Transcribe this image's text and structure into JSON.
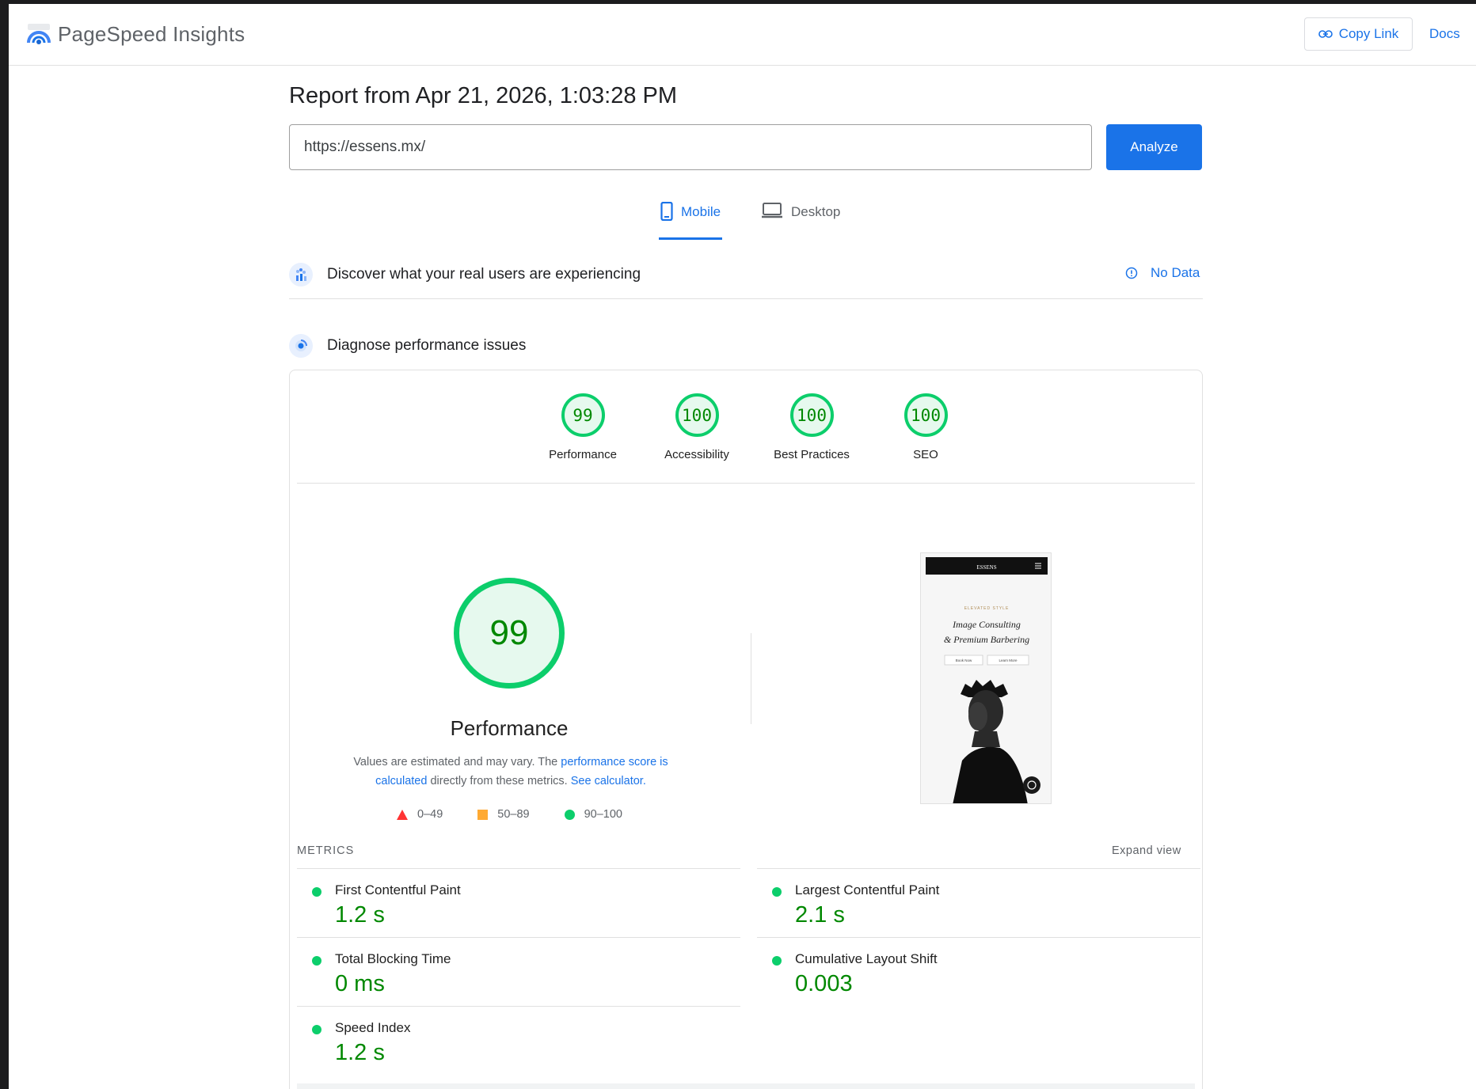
{
  "app": {
    "title": "PageSpeed Insights"
  },
  "topbar": {
    "copy_link": "Copy Link",
    "docs": "Docs"
  },
  "report": {
    "title": "Report from Apr 21, 2026, 1:03:28 PM"
  },
  "search": {
    "url": "https://essens.mx/",
    "analyze": "Analyze"
  },
  "tabs": [
    {
      "label": "Mobile",
      "active": true
    },
    {
      "label": "Desktop",
      "active": false
    }
  ],
  "crux": {
    "title": "Discover what your real users are experiencing",
    "status": "No Data"
  },
  "diagnose": {
    "title": "Diagnose performance issues"
  },
  "categories": [
    {
      "score": "99",
      "label": "Performance"
    },
    {
      "score": "100",
      "label": "Accessibility"
    },
    {
      "score": "100",
      "label": "Best Practices"
    },
    {
      "score": "100",
      "label": "SEO"
    }
  ],
  "performance": {
    "score": "99",
    "label": "Performance",
    "desc_before": "Values are estimated and may vary. The ",
    "desc_link1": "performance score is calculated",
    "desc_middle": " directly from these metrics. ",
    "desc_link2": "See calculator."
  },
  "legend": [
    {
      "range": "0–49",
      "color": "#ff3333"
    },
    {
      "range": "50–89",
      "color": "#ffaa33"
    },
    {
      "range": "90–100",
      "color": "#0cce6b"
    }
  ],
  "screenshot": {
    "brand": "ESSENS",
    "tagline": "ELEVATED STYLE",
    "headline1": "Image Consulting",
    "headline2": "& Premium Barbering",
    "btn1": "Book Now",
    "btn2": "Learn More"
  },
  "metrics": {
    "header": "METRICS",
    "expand": "Expand view",
    "items": [
      {
        "name": "First Contentful Paint",
        "value": "1.2 s"
      },
      {
        "name": "Largest Contentful Paint",
        "value": "2.1 s"
      },
      {
        "name": "Total Blocking Time",
        "value": "0 ms"
      },
      {
        "name": "Cumulative Layout Shift",
        "value": "0.003"
      },
      {
        "name": "Speed Index",
        "value": "1.2 s"
      }
    ]
  }
}
